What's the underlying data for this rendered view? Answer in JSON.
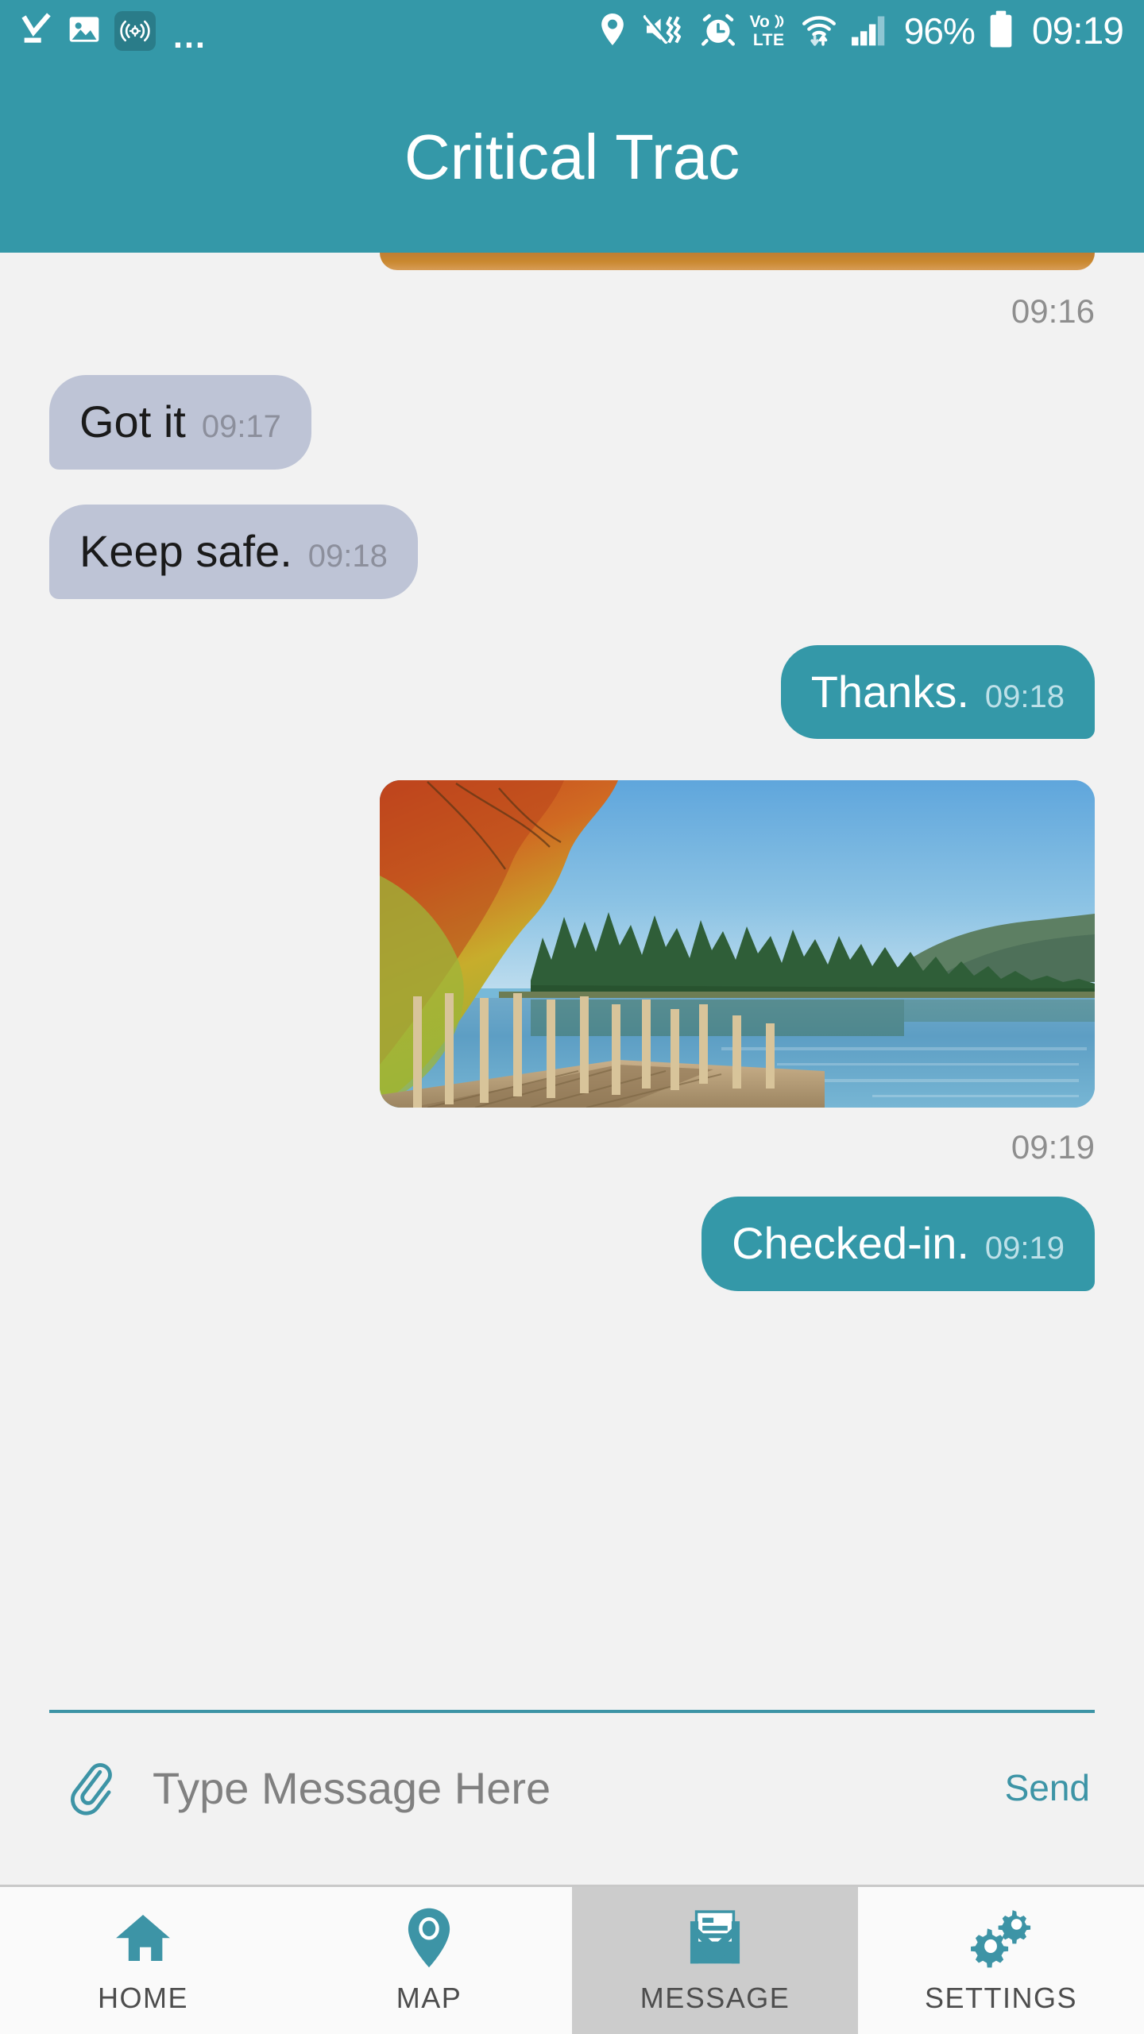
{
  "status_bar": {
    "left_icons": [
      {
        "name": "download-complete-icon",
        "label": "download complete"
      },
      {
        "name": "image-saved-icon",
        "label": "screenshot saved"
      },
      {
        "name": "gps-beacon-icon",
        "label": "location tracking active"
      },
      {
        "name": "more-notifications-icon",
        "label": "..."
      }
    ],
    "right_icons": [
      {
        "name": "location-pin-icon",
        "label": "location"
      },
      {
        "name": "mute-vibrate-icon",
        "label": "sound off vibrate"
      },
      {
        "name": "alarm-clock-icon",
        "label": "alarm set"
      },
      {
        "name": "volte-icon",
        "label": "VoLTE"
      },
      {
        "name": "wifi-icon",
        "label": "wifi"
      },
      {
        "name": "signal-bars-icon",
        "label": "cellular signal"
      },
      {
        "name": "battery-icon",
        "label": "battery"
      }
    ],
    "volte_line1": "Vo",
    "volte_line2": "LTE",
    "battery_percent": "96%",
    "clock": "09:19"
  },
  "app_bar": {
    "title": "Critical Trac",
    "background": "#3498a8"
  },
  "chat": {
    "top_photo_time": "09:16",
    "messages": [
      {
        "id": "msg-got-it",
        "direction": "incoming",
        "type": "text",
        "text": "Got it",
        "time": "09:17"
      },
      {
        "id": "msg-keep-safe",
        "direction": "incoming",
        "type": "text",
        "text": "Keep safe.",
        "time": "09:18"
      },
      {
        "id": "msg-thanks",
        "direction": "outgoing",
        "type": "text",
        "text": "Thanks.",
        "time": "09:18"
      },
      {
        "id": "msg-photo",
        "direction": "outgoing",
        "type": "image",
        "alt": "Autumn lakeside with wooden dock, pine forest and blue sky",
        "time": "09:19"
      },
      {
        "id": "msg-checked-in",
        "direction": "outgoing",
        "type": "text",
        "text": "Checked-in.",
        "time": "09:19"
      }
    ]
  },
  "composer": {
    "attach_icon": "paperclip-icon",
    "input_value": "",
    "placeholder": "Type Message Here",
    "send_label": "Send"
  },
  "bottom_nav": {
    "items": [
      {
        "id": "home",
        "label": "HOME",
        "icon": "home-icon",
        "active": false
      },
      {
        "id": "map",
        "label": "MAP",
        "icon": "map-pin-icon",
        "active": false
      },
      {
        "id": "message",
        "label": "MESSAGE",
        "icon": "envelope-icon",
        "active": true
      },
      {
        "id": "settings",
        "label": "SETTINGS",
        "icon": "gears-icon",
        "active": false
      }
    ]
  },
  "colors": {
    "accent_teal": "#3498a8",
    "incoming_bubble": "#bec4d6",
    "outgoing_bubble": "#3498a8",
    "chat_background": "#f2f2f2",
    "nav_active": "#cccccc",
    "timestamp_gray": "#8e8e8e"
  }
}
